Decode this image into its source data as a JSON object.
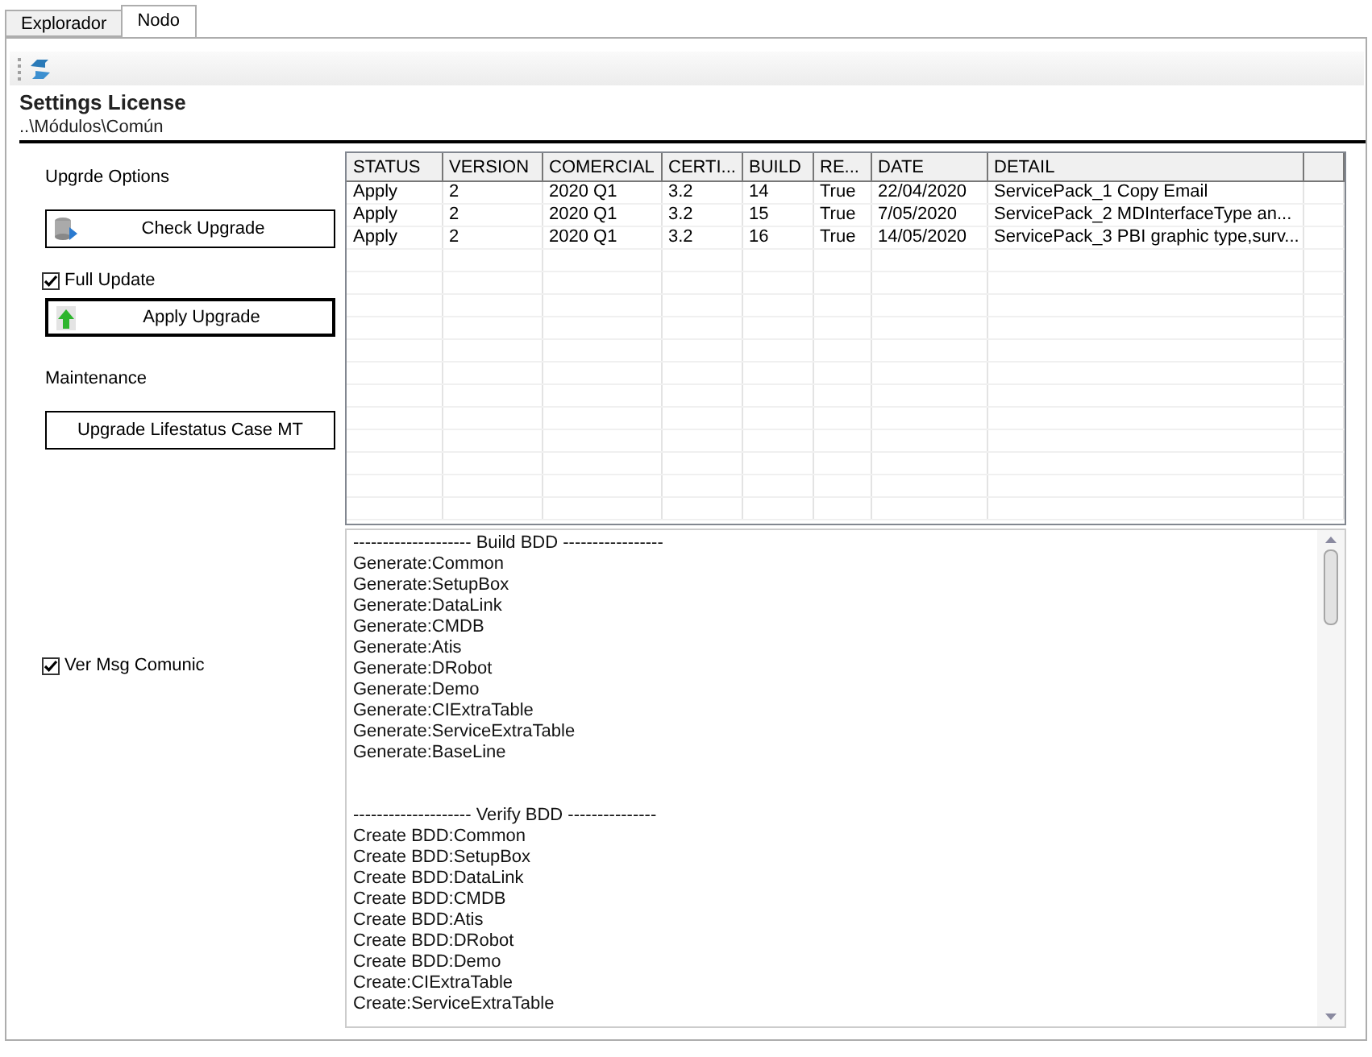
{
  "tabs": [
    {
      "label": "Explorador",
      "selected": false
    },
    {
      "label": "Nodo",
      "selected": true
    }
  ],
  "header": {
    "title": "Settings License",
    "path": "..\\Módulos\\Común"
  },
  "options": {
    "upgrade_heading": "Upgrde Options",
    "check_button": "Check Upgrade",
    "full_update": {
      "label": "Full Update",
      "checked": true
    },
    "apply_button": "Apply Upgrade",
    "maintenance_heading": "Maintenance",
    "lifestatus_button": "Upgrade Lifestatus Case MT",
    "ver_msg": {
      "label": "Ver Msg Comunic",
      "checked": true
    }
  },
  "table": {
    "columns": [
      "STATUS",
      "VERSION",
      "COMERCIAL",
      "CERTI...",
      "BUILD",
      "RE...",
      "DATE",
      "DETAIL"
    ],
    "rows": [
      [
        "Apply",
        "2",
        "2020 Q1",
        "3.2",
        "14",
        "True",
        "22/04/2020",
        "ServicePack_1 Copy Email"
      ],
      [
        "Apply",
        "2",
        "2020 Q1",
        "3.2",
        "15",
        "True",
        "7/05/2020",
        "ServicePack_2 MDInterfaceType an..."
      ],
      [
        "Apply",
        "2",
        "2020 Q1",
        "3.2",
        "16",
        "True",
        "14/05/2020",
        "ServicePack_3 PBI graphic type,surv..."
      ]
    ]
  },
  "log": [
    {
      "heading": "-------------------- Build BDD -----------------",
      "lines": [
        "Generate:Common",
        "Generate:SetupBox",
        "Generate:DataLink",
        "Generate:CMDB",
        "Generate:Atis",
        "Generate:DRobot",
        "Generate:Demo",
        "Generate:CIExtraTable",
        "Generate:ServiceExtraTable",
        "Generate:BaseLine"
      ]
    },
    {
      "heading": "-------------------- Verify BDD ---------------",
      "lines": [
        "Create BDD:Common",
        "Create BDD:SetupBox",
        "Create BDD:DataLink",
        "Create BDD:CMDB",
        "Create BDD:Atis",
        "Create BDD:DRobot",
        "Create BDD:Demo",
        "Create:CIExtraTable",
        "Create:ServiceExtraTable"
      ]
    }
  ]
}
